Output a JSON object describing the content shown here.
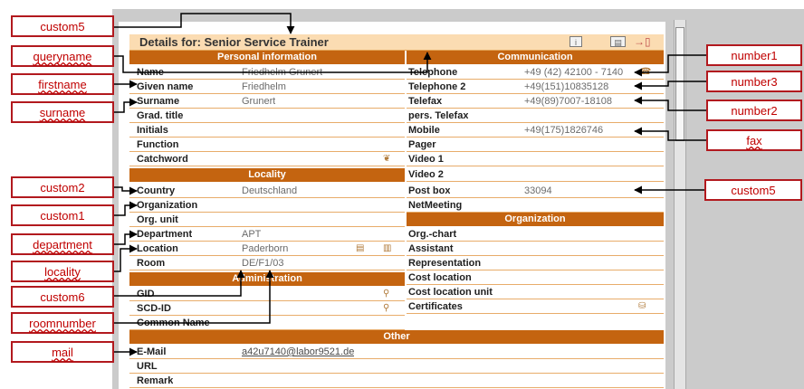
{
  "title": "Details for: Senior Service Trainer",
  "sections": {
    "personal": "Personal information",
    "communication": "Communication",
    "locality": "Locality",
    "organization": "Organization",
    "administration": "Administration",
    "other": "Other"
  },
  "left_rows": [
    {
      "label": "Name",
      "value": "Friedhelm Grunert"
    },
    {
      "label": "Given name",
      "value": "Friedhelm"
    },
    {
      "label": "Surname",
      "value": "Grunert"
    },
    {
      "label": "Grad. title",
      "value": ""
    },
    {
      "label": "Initials",
      "value": ""
    },
    {
      "label": "Function",
      "value": ""
    },
    {
      "label": "Catchword",
      "value": ""
    },
    {
      "label": "Country",
      "value": "Deutschland"
    },
    {
      "label": "Organization",
      "value": ""
    },
    {
      "label": "Org. unit",
      "value": ""
    },
    {
      "label": "Department",
      "value": "APT"
    },
    {
      "label": "Location",
      "value": "Paderborn"
    },
    {
      "label": "Room",
      "value": "DE/F1/03"
    },
    {
      "label": "GID",
      "value": ""
    },
    {
      "label": "SCD-ID",
      "value": ""
    },
    {
      "label": "Common Name",
      "value": ""
    }
  ],
  "right_rows": [
    {
      "label": "Telephone",
      "value": "+49 (42) 42100 - 7140"
    },
    {
      "label": "Telephone 2",
      "value": "+49(151)10835128"
    },
    {
      "label": "Telefax",
      "value": "+49(89)7007-18108"
    },
    {
      "label": "pers. Telefax",
      "value": ""
    },
    {
      "label": "Mobile",
      "value": "+49(175)1826746"
    },
    {
      "label": "Pager",
      "value": ""
    },
    {
      "label": "Video 1",
      "value": ""
    },
    {
      "label": "Video 2",
      "value": ""
    },
    {
      "label": "Post box",
      "value": "33094"
    },
    {
      "label": "NetMeeting",
      "value": ""
    },
    {
      "label": "Org.-chart",
      "value": ""
    },
    {
      "label": "Assistant",
      "value": ""
    },
    {
      "label": "Representation",
      "value": ""
    },
    {
      "label": "Cost location",
      "value": ""
    },
    {
      "label": "Cost location unit",
      "value": ""
    },
    {
      "label": "Certificates",
      "value": ""
    }
  ],
  "other_rows": [
    {
      "label": "E-Mail",
      "value": "a42u7140@labor9521.de"
    },
    {
      "label": "URL",
      "value": ""
    },
    {
      "label": "Remark",
      "value": ""
    }
  ],
  "annotations_left": [
    "custom5",
    "queryname",
    "firstname",
    "surname",
    "custom2",
    "custom1",
    "department",
    "locality",
    "custom6",
    "roomnumber",
    "mail"
  ],
  "annotations_right": [
    "number1",
    "number3",
    "number2",
    "fax",
    "custom5"
  ],
  "colors": {
    "section": "#c46410",
    "title_bar": "#fbdcb2",
    "annotation_border": "#b2191e",
    "annotation_text": "#c00000"
  }
}
